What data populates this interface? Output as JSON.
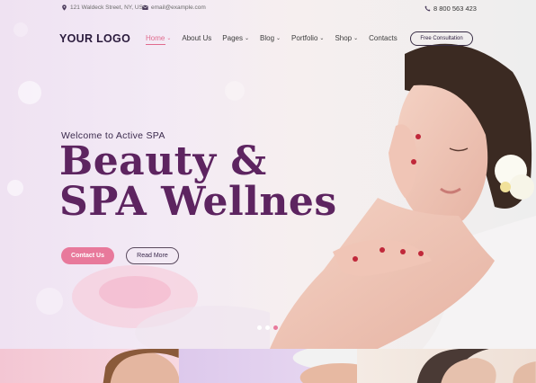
{
  "topbar": {
    "address": "121 Waldeck Street, NY, USA",
    "email": "email@example.com",
    "phone": "8 800 563 423",
    "address_icon": "map-pin-icon",
    "email_icon": "envelope-icon",
    "phone_icon": "phone-icon"
  },
  "header": {
    "logo": "YOUR LOGO",
    "nav": [
      {
        "label": "Home",
        "dropdown": true,
        "active": true
      },
      {
        "label": "About Us",
        "dropdown": false
      },
      {
        "label": "Pages",
        "dropdown": true
      },
      {
        "label": "Blog",
        "dropdown": true
      },
      {
        "label": "Portfolio",
        "dropdown": true
      },
      {
        "label": "Shop",
        "dropdown": true
      },
      {
        "label": "Contacts",
        "dropdown": false
      }
    ],
    "cta": "Free Consultation"
  },
  "hero": {
    "subtitle": "Welcome to Active SPA",
    "title_line1": "Beauty &",
    "title_line2": "SPA Wellnes",
    "primary_button": "Contact Us",
    "secondary_button": "Read More",
    "slides": 3,
    "active_slide": 3
  },
  "colors": {
    "accent": "#e8799b",
    "headline": "#5d2460",
    "logo": "#2b1b3d"
  },
  "strip_tiles": 4
}
